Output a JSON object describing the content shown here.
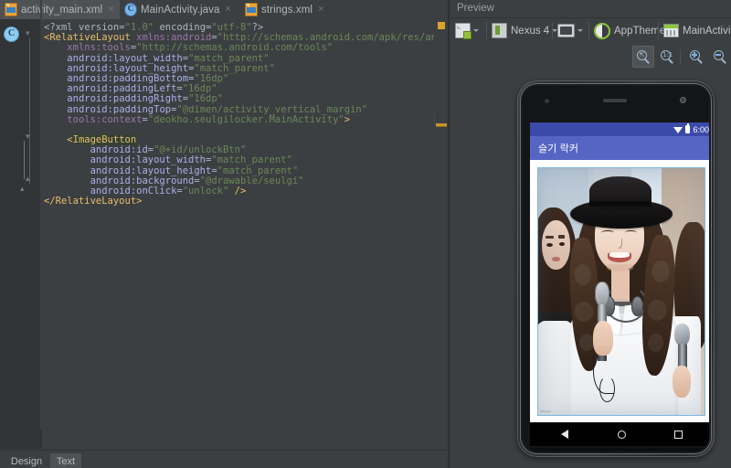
{
  "editor": {
    "tabs": [
      {
        "label": "activity_main.xml",
        "icon": "xml-file-icon",
        "active": true,
        "close": "×"
      },
      {
        "label": "MainActivity.java",
        "icon": "java-class-icon",
        "active": false,
        "close": "×"
      },
      {
        "label": "strings.xml",
        "icon": "xml-file-icon",
        "active": false,
        "close": "×"
      }
    ],
    "gutter_badge": "C",
    "bottom_tabs": [
      {
        "label": "Design",
        "active": false
      },
      {
        "label": "Text",
        "active": true
      }
    ],
    "code_lines": [
      [
        [
          "punct",
          "<?"
        ],
        [
          "decl",
          "xml version="
        ],
        [
          "val",
          "\"1.0\""
        ],
        [
          "decl",
          " encoding="
        ],
        [
          "val",
          "\"utf-8\""
        ],
        [
          "punct",
          "?>"
        ]
      ],
      [
        [
          "tag",
          "<RelativeLayout"
        ],
        [
          "plain",
          " "
        ],
        [
          "ns",
          "xmlns:android"
        ],
        [
          "punct",
          "="
        ],
        [
          "val",
          "\"http://schemas.android.com/apk/res/android\""
        ]
      ],
      [
        [
          "plain",
          "    "
        ],
        [
          "ns",
          "xmlns:tools"
        ],
        [
          "punct",
          "="
        ],
        [
          "val",
          "\"http://schemas.android.com/tools\""
        ]
      ],
      [
        [
          "plain",
          "    "
        ],
        [
          "attr",
          "android:layout_width"
        ],
        [
          "punct",
          "="
        ],
        [
          "val",
          "\"match_parent\""
        ]
      ],
      [
        [
          "plain",
          "    "
        ],
        [
          "attr",
          "android:layout_height"
        ],
        [
          "punct",
          "="
        ],
        [
          "val",
          "\"match_parent\""
        ]
      ],
      [
        [
          "plain",
          "    "
        ],
        [
          "attr",
          "android:paddingBottom"
        ],
        [
          "punct",
          "="
        ],
        [
          "val",
          "\"16dp\""
        ]
      ],
      [
        [
          "plain",
          "    "
        ],
        [
          "attr",
          "android:paddingLeft"
        ],
        [
          "punct",
          "="
        ],
        [
          "val",
          "\"16dp\""
        ]
      ],
      [
        [
          "plain",
          "    "
        ],
        [
          "attr",
          "android:paddingRight"
        ],
        [
          "punct",
          "="
        ],
        [
          "val",
          "\"16dp\""
        ]
      ],
      [
        [
          "plain",
          "    "
        ],
        [
          "attr",
          "android:paddingTop"
        ],
        [
          "punct",
          "="
        ],
        [
          "val",
          "\"@dimen/activity_vertical_margin\""
        ]
      ],
      [
        [
          "plain",
          "    "
        ],
        [
          "ns",
          "tools:context"
        ],
        [
          "punct",
          "="
        ],
        [
          "val",
          "\"deokho.seulgilocker.MainActivity\""
        ],
        [
          "tag",
          ">"
        ]
      ],
      [],
      [
        [
          "plain",
          "    "
        ],
        [
          "tag",
          "<"
        ],
        [
          "tagsel",
          "ImageButton"
        ]
      ],
      [
        [
          "plain",
          "        "
        ],
        [
          "attr",
          "android:id"
        ],
        [
          "punct",
          "="
        ],
        [
          "val",
          "\"@+id/unlockBtn\""
        ]
      ],
      [
        [
          "plain",
          "        "
        ],
        [
          "attr",
          "android:layout_width"
        ],
        [
          "punct",
          "="
        ],
        [
          "val",
          "\"match_parent\""
        ]
      ],
      [
        [
          "plain",
          "        "
        ],
        [
          "attr",
          "android:layout_height"
        ],
        [
          "punct",
          "="
        ],
        [
          "val",
          "\"match_parent\""
        ]
      ],
      [
        [
          "plain",
          "        "
        ],
        [
          "attr",
          "android:background"
        ],
        [
          "punct",
          "="
        ],
        [
          "val",
          "\"@drawable/seulgi\""
        ]
      ],
      [
        [
          "plain",
          "        "
        ],
        [
          "attr",
          "android:onClick"
        ],
        [
          "punct",
          "="
        ],
        [
          "val",
          "\"unlock\""
        ],
        [
          "plain",
          " "
        ],
        [
          "slash",
          "/>"
        ]
      ],
      [
        [
          "tag",
          "</RelativeLayout>"
        ]
      ]
    ]
  },
  "preview": {
    "title": "Preview",
    "toolbar": [
      {
        "label": "",
        "icon": "configuration-icon",
        "caret": true
      },
      {
        "label": "Nexus 4",
        "icon": "device-icon",
        "caret": true
      },
      {
        "label": "",
        "icon": "orientation-icon",
        "caret": true
      },
      {
        "label": "AppTheme",
        "icon": "theme-icon",
        "caret": false
      },
      {
        "label": "MainActivity",
        "icon": "activity-icon",
        "caret": true
      }
    ],
    "zoom_buttons": [
      {
        "name": "zoom-to-fit-icon",
        "active": true
      },
      {
        "name": "zoom-actual-size-icon",
        "active": false
      },
      {
        "name": "zoom-in-icon",
        "active": false
      },
      {
        "name": "zoom-out-icon",
        "active": false
      }
    ]
  },
  "device": {
    "name": "Nexus 4",
    "status_bar": {
      "time": "6:00",
      "wifi": "wifi-icon",
      "battery": "battery-icon"
    },
    "app_bar_title": "슬기 락커",
    "photo_watermark": "SEULGI",
    "nav": [
      {
        "name": "back-button",
        "glyph": "triangle"
      },
      {
        "name": "home-button",
        "glyph": "circle"
      },
      {
        "name": "recents-button",
        "glyph": "square"
      }
    ]
  },
  "colors": {
    "ide_bg": "#3c3f41",
    "editor_bg": "#3c3f41",
    "gutter_bg": "#313335",
    "status_bar": "#3b4aa8",
    "app_bar": "#5664c4",
    "accent_green": "#8cc63f",
    "marker_yellow": "#c8952a"
  }
}
